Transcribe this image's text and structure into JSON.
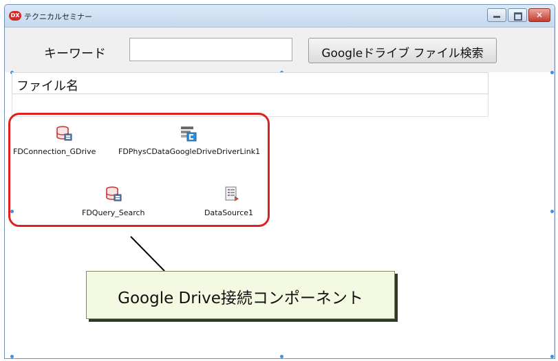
{
  "window": {
    "title": "テクニカルセミナー",
    "app_icon_text": "DX"
  },
  "search_panel": {
    "keyword_label": "キーワード",
    "keyword_value": "",
    "search_button_label": "Googleドライブ ファイル検索"
  },
  "grid": {
    "column_header": "ファイル名",
    "rows": [
      ""
    ]
  },
  "components": [
    {
      "name": "FDConnection_GDrive",
      "icon": "database-connection-icon"
    },
    {
      "name": "FDPhysCDataGoogleDriveDriverLink1",
      "icon": "driver-link-icon"
    },
    {
      "name": "FDQuery_Search",
      "icon": "database-query-icon"
    },
    {
      "name": "DataSource1",
      "icon": "data-source-icon"
    }
  ],
  "callout": {
    "text": "Google Drive接続コンポーネント"
  },
  "colors": {
    "highlight_border": "#e02020",
    "callout_background": "#f4f9e1",
    "titlebar": "#c4d9ef",
    "close_button": "#c63a2b"
  }
}
